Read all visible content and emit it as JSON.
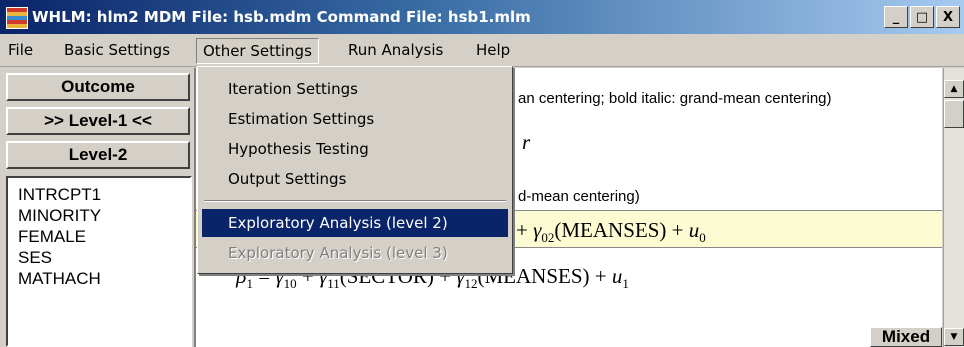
{
  "window": {
    "title": "WHLM: hlm2 MDM File: hsb.mdm   Command File: hsb1.mlm",
    "minimize": "_",
    "maximize": "□",
    "close": "X"
  },
  "menubar": [
    "File",
    "Basic Settings",
    "Other Settings",
    "Run Analysis",
    "Help"
  ],
  "dropdown": {
    "items": [
      "Iteration Settings",
      "Estimation Settings",
      "Hypothesis Testing",
      "Output Settings"
    ],
    "selected": "Exploratory Analysis (level 2)",
    "disabled": "Exploratory Analysis (level 3)"
  },
  "nav": {
    "outcome": "Outcome",
    "level1": ">> Level-1 <<",
    "level2": "Level-2"
  },
  "variables": [
    "INTRCPT1",
    "MINORITY",
    "FEMALE",
    "SES",
    "MATHACH"
  ],
  "equations": {
    "legend": "an centering; bold italic: grand-mean centering)",
    "partial_r": "r",
    "level2_note": "d-mean centering)",
    "beta0_tail": "+ γ02(MEANSES) + u0",
    "beta1": "β1 = γ10 + γ11(SECTOR) + γ12(MEANSES) + u1"
  },
  "bottom": {
    "mixed": "Mixed"
  }
}
